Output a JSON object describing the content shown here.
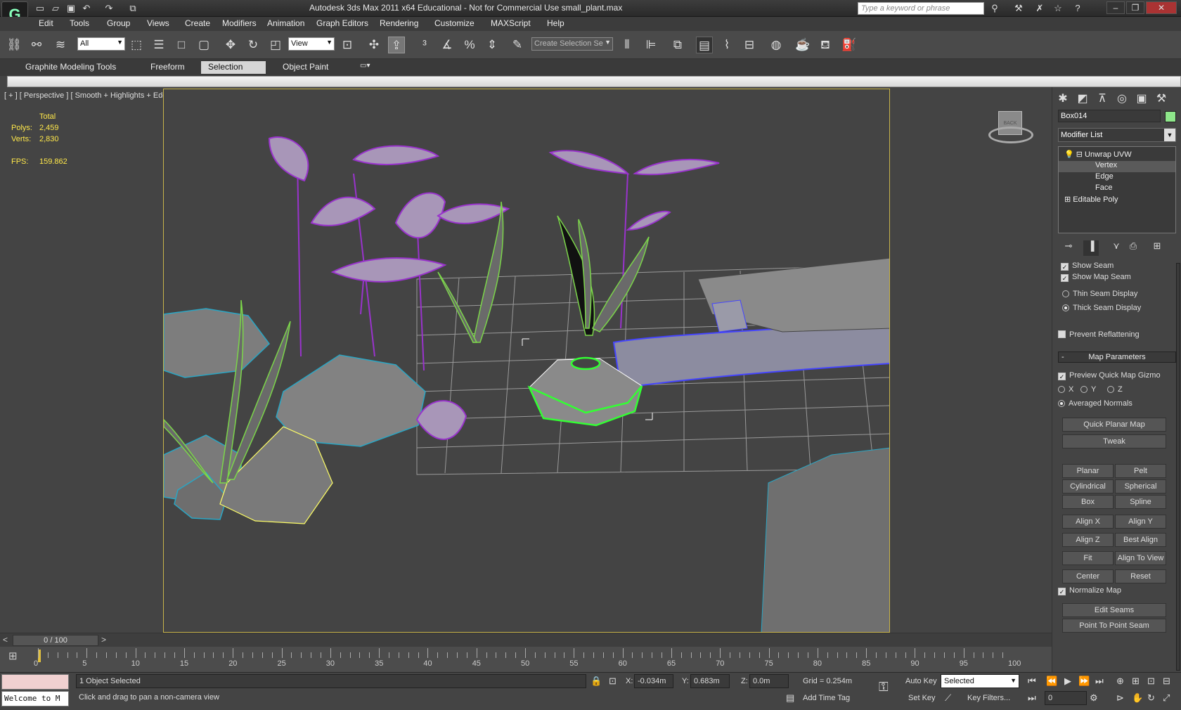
{
  "titlebar": {
    "title": "Autodesk 3ds Max  2011 x64   Educational - Not for Commercial Use    small_plant.max",
    "search_placeholder": "Type a keyword or phrase"
  },
  "menu": [
    "Edit",
    "Tools",
    "Group",
    "Views",
    "Create",
    "Modifiers",
    "Animation",
    "Graph Editors",
    "Rendering",
    "Customize",
    "MAXScript",
    "Help"
  ],
  "toolbar": {
    "selection_filter": "All",
    "reference_coord": "View",
    "named_selection": "Create Selection Se"
  },
  "ribbon": {
    "tabs": [
      "Graphite Modeling Tools",
      "Freeform",
      "Selection",
      "Object Paint"
    ],
    "active_tab": "Selection"
  },
  "viewport": {
    "label": "[ + ] [ Perspective ] [ Smooth + Highlights + Edged Faces ]",
    "stats": {
      "total_label": "Total",
      "polys_label": "Polys:",
      "polys_value": "2,459",
      "verts_label": "Verts:",
      "verts_value": "2,830",
      "fps_label": "FPS:",
      "fps_value": "159.862"
    },
    "viewcube_label": "BACK"
  },
  "command_panel": {
    "object_name": "Box014",
    "object_color": "#8ee68a",
    "modifier_list": "Modifier List",
    "stack": [
      {
        "label": "Unwrap UVW",
        "level": 0
      },
      {
        "label": "Vertex",
        "level": 1
      },
      {
        "label": "Edge",
        "level": 1
      },
      {
        "label": "Face",
        "level": 1
      },
      {
        "label": "Editable Poly",
        "level": 0
      }
    ],
    "show_seam": "Show Seam",
    "show_map_seam": "Show Map Seam",
    "thin_seam": "Thin Seam Display",
    "thick_seam": "Thick Seam Display",
    "prevent_reflattening": "Prevent Reflattening",
    "map_parameters": {
      "collapse_symbol": "-",
      "title": "Map Parameters",
      "preview_gizmo": "Preview Quick Map Gizmo",
      "axes": [
        "X",
        "Y",
        "Z"
      ],
      "averaged_normals": "Averaged Normals",
      "quick_planar_map": "Quick Planar Map",
      "tweak": "Tweak",
      "planar": "Planar",
      "pelt": "Pelt",
      "cylindrical": "Cylindrical",
      "spherical": "Spherical",
      "box": "Box",
      "spline": "Spline",
      "align_x": "Align X",
      "align_y": "Align Y",
      "align_z": "Align Z",
      "best_align": "Best Align",
      "fit": "Fit",
      "align_to_view": "Align To View",
      "center": "Center",
      "reset": "Reset",
      "normalize_map": "Normalize Map",
      "edit_seams": "Edit Seams",
      "point_to_point_seam": "Point To Point Seam"
    }
  },
  "timeline": {
    "frame_display": "0 / 100",
    "ticks": [
      "0",
      "5",
      "10",
      "15",
      "20",
      "25",
      "30",
      "35",
      "40",
      "45",
      "50",
      "55",
      "60",
      "65",
      "70",
      "75",
      "80",
      "85",
      "90",
      "95",
      "100"
    ]
  },
  "statusbar": {
    "welcome": "Welcome to M",
    "selection_status": "1 Object Selected",
    "prompt": "Click and drag to pan a non-camera view",
    "x_label": "X:",
    "x_value": "-0.034m",
    "y_label": "Y:",
    "y_value": "0.683m",
    "z_label": "Z:",
    "z_value": "0.0m",
    "grid": "Grid = 0.254m",
    "add_time_tag": "Add Time Tag",
    "auto_key": "Auto Key",
    "set_key": "Set Key",
    "key_mode": "Selected",
    "key_filters": "Key Filters...",
    "current_frame": "0"
  }
}
